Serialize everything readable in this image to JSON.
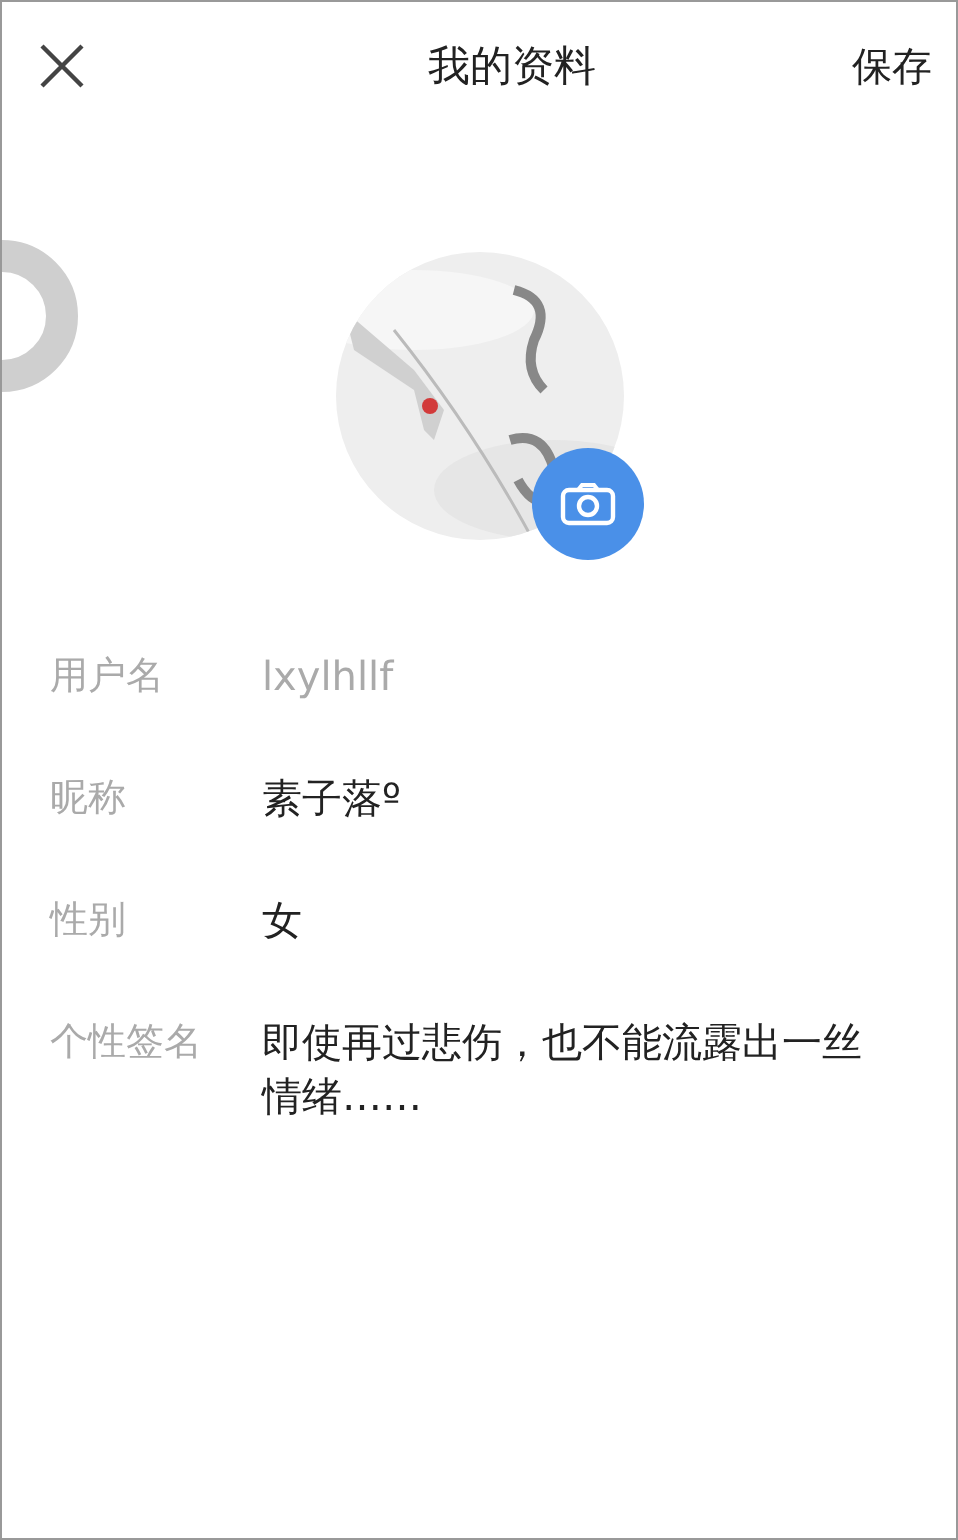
{
  "header": {
    "title": "我的资料",
    "save": "保存"
  },
  "fields": [
    {
      "label": "用户名",
      "value": "lxylhllf",
      "disabled": true
    },
    {
      "label": "昵称",
      "value": "素子落º",
      "disabled": false
    },
    {
      "label": "性别",
      "value": "女",
      "disabled": false
    },
    {
      "label": "个性签名",
      "value": "即使再过悲伤，也不能流露出一丝情绪……",
      "disabled": false
    }
  ]
}
